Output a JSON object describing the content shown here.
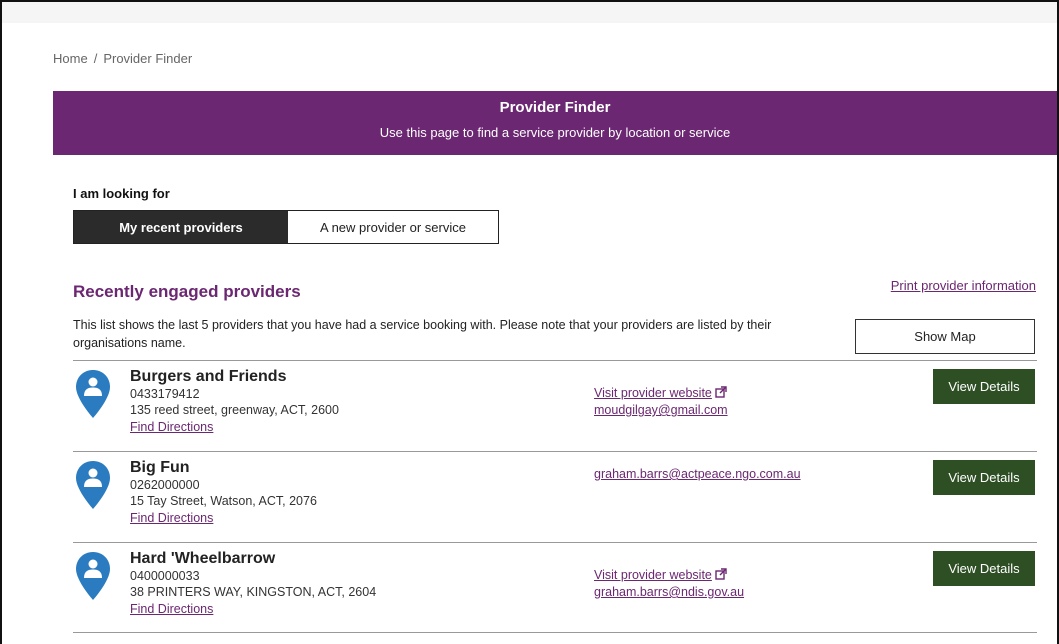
{
  "breadcrumb": {
    "home": "Home",
    "separator": "/",
    "current": "Provider Finder"
  },
  "banner": {
    "title": "Provider Finder",
    "subtitle": "Use this page to find a service provider by location or service",
    "color": "#6b2771"
  },
  "search": {
    "label": "I am looking for",
    "options": [
      {
        "label": "My recent providers",
        "active": true
      },
      {
        "label": "A new provider or service",
        "active": false
      }
    ]
  },
  "recent": {
    "title": "Recently engaged providers",
    "print_link": "Print provider information",
    "description": "This list shows the last 5 providers that you have had a service booking with. Please note that your providers are listed by their organisations name.",
    "show_map": "Show Map",
    "providers": [
      {
        "name": "Burgers and Friends",
        "phone": "0433179412",
        "address": "135 reed street, greenway, ACT, 2600",
        "directions": "Find Directions",
        "website": "Visit provider website",
        "email": "moudgilgay@gmail.com",
        "view": "View Details"
      },
      {
        "name": "Big Fun",
        "phone": "0262000000",
        "address": "15 Tay Street, Watson, ACT, 2076",
        "directions": "Find Directions",
        "website": "",
        "email": "graham.barrs@actpeace.ngo.com.au",
        "view": "View Details"
      },
      {
        "name": "Hard 'Wheelbarrow",
        "phone": "0400000033",
        "address": "38 PRINTERS WAY, KINGSTON, ACT, 2604",
        "directions": "Find Directions",
        "website": "Visit provider website",
        "email": "graham.barrs@ndis.gov.au",
        "view": "View Details"
      }
    ]
  },
  "icons": {
    "pin": "location-pin-person-icon",
    "external": "external-link-icon"
  },
  "colors": {
    "accent": "#6b2771",
    "button": "#2e4f24",
    "pin": "#2a7bbf",
    "active_toggle": "#2b2b2b"
  }
}
